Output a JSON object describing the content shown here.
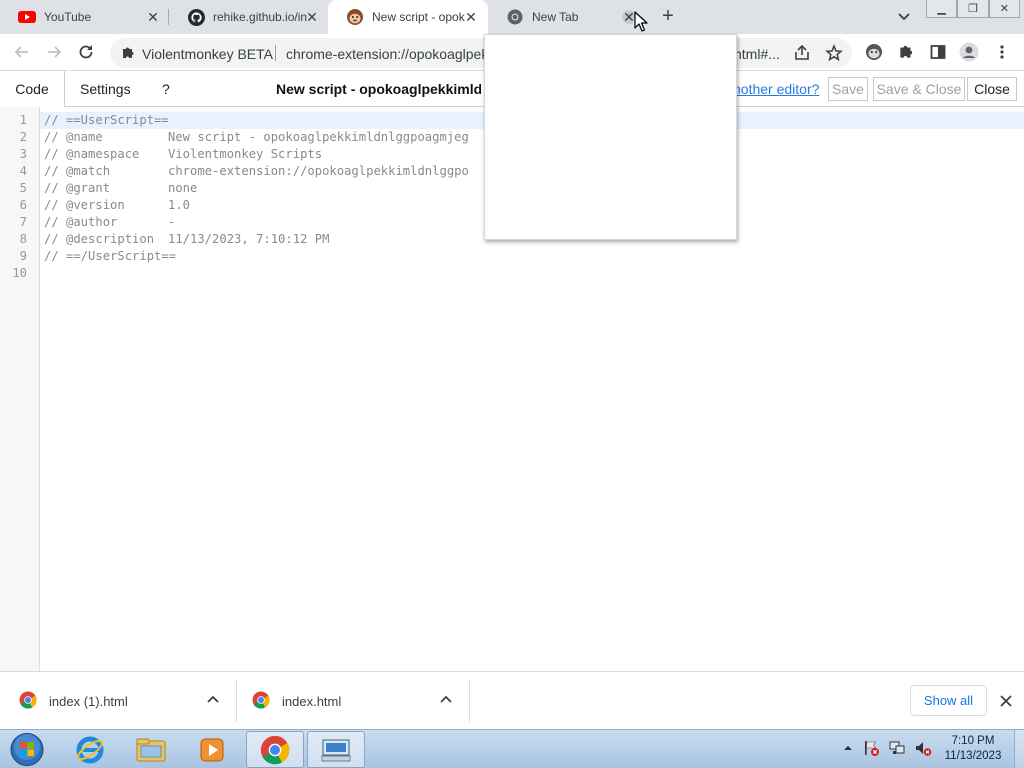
{
  "browser": {
    "tabs": [
      {
        "title": "YouTube",
        "icon": "youtube-icon"
      },
      {
        "title": "rehike.github.io/in",
        "icon": "github-icon"
      },
      {
        "title": "New script - opok",
        "icon": "violentmonkey-icon"
      },
      {
        "title": "New Tab",
        "icon": "chrome-icon"
      }
    ],
    "new_tab_label": "+",
    "window_controls": {
      "minimize": "▁",
      "maximize": "❐",
      "close": "✕"
    }
  },
  "toolbar": {
    "extension_name": "Violentmonkey BETA",
    "url": "chrome-extension://opokoaglpekkimldnlggpoagmjegichg/",
    "url_tail": "html#..."
  },
  "editor": {
    "tabs": {
      "code": "Code",
      "settings": "Settings",
      "help": "?"
    },
    "title": "New script - opokoaglpekkimldnlggpoagmjegichg",
    "another_editor_link": "nother editor?",
    "buttons": {
      "save": "Save",
      "save_close": "Save & Close",
      "close": "Close"
    },
    "lines": [
      {
        "num": "1",
        "key": "// ==UserScript==",
        "value": ""
      },
      {
        "num": "2",
        "key": "// @name",
        "value": "New script - opokoaglpekkimldnlggpoagmjeg"
      },
      {
        "num": "3",
        "key": "// @namespace",
        "value": "Violentmonkey Scripts"
      },
      {
        "num": "4",
        "key": "// @match",
        "value": "chrome-extension://opokoaglpekkimldnlggpo"
      },
      {
        "num": "5",
        "key": "// @grant",
        "value": "none"
      },
      {
        "num": "6",
        "key": "// @version",
        "value": "1.0"
      },
      {
        "num": "7",
        "key": "// @author",
        "value": "-"
      },
      {
        "num": "8",
        "key": "// @description",
        "value": "11/13/2023, 7:10:12 PM"
      },
      {
        "num": "9",
        "key": "// ==/UserScript==",
        "value": ""
      },
      {
        "num": "10",
        "key": "",
        "value": ""
      }
    ]
  },
  "downloads": {
    "items": [
      {
        "name": "index (1).html"
      },
      {
        "name": "index.html"
      }
    ],
    "show_all": "Show all"
  },
  "taskbar": {
    "apps": [
      "internet-explorer-icon",
      "file-explorer-icon",
      "media-player-icon",
      "chrome-icon",
      "keyboard-app-icon"
    ],
    "clock_time": "7:10 PM",
    "clock_date": "11/13/2023"
  },
  "colors": {
    "tab_strip": "#dee1e6",
    "link": "#2a7ae2",
    "accent": "#1a73e8",
    "taskbar": "#b5cde6"
  }
}
